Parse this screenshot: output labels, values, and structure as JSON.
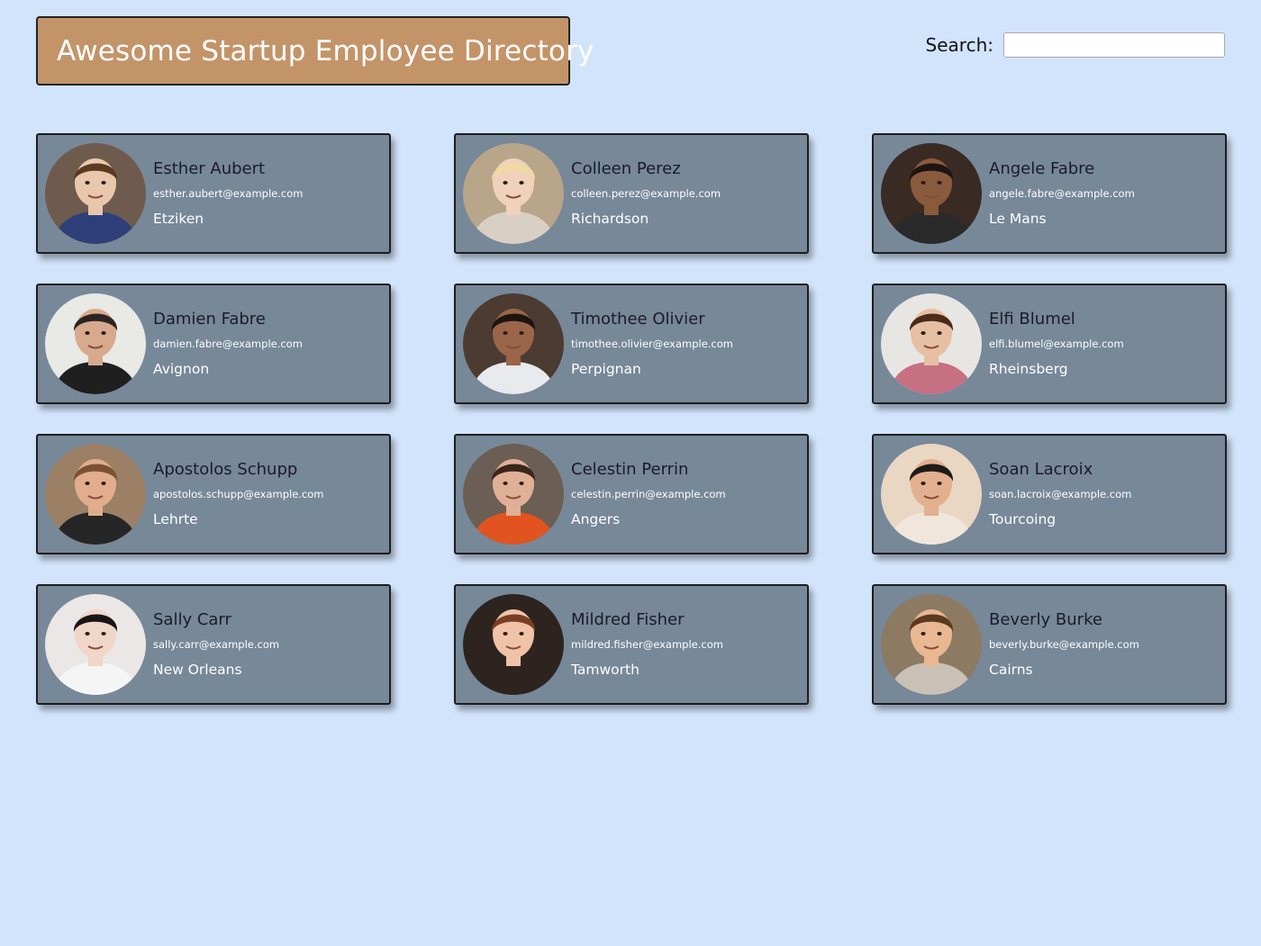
{
  "header": {
    "title": "Awesome Startup Employee Directory"
  },
  "search": {
    "label": "Search:",
    "value": "",
    "placeholder": ""
  },
  "employees": [
    {
      "name": "Esther Aubert",
      "email": "esther.aubert@example.com",
      "city": "Etziken",
      "avatar": {
        "bg": "#6f5b4d",
        "skin": "#e9c7ad",
        "hair": "#5a3b22",
        "shirt": "#2f3f7a"
      }
    },
    {
      "name": "Colleen Perez",
      "email": "colleen.perez@example.com",
      "city": "Richardson",
      "avatar": {
        "bg": "#b9a58a",
        "skin": "#f0d2bc",
        "hair": "#f1d9a3",
        "shirt": "#d9cfc4"
      }
    },
    {
      "name": "Angele Fabre",
      "email": "angele.fabre@example.com",
      "city": "Le Mans",
      "avatar": {
        "bg": "#3a2a24",
        "skin": "#8a5a3c",
        "hair": "#1c1512",
        "shirt": "#2a2a2a"
      }
    },
    {
      "name": "Damien Fabre",
      "email": "damien.fabre@example.com",
      "city": "Avignon",
      "avatar": {
        "bg": "#e9e9e6",
        "skin": "#d7a98d",
        "hair": "#2b2420",
        "shirt": "#1f1f1f"
      }
    },
    {
      "name": "Timothee Olivier",
      "email": "timothee.olivier@example.com",
      "city": "Perpignan",
      "avatar": {
        "bg": "#4c3b30",
        "skin": "#9a6548",
        "hair": "#1c1410",
        "shirt": "#e9eaee"
      }
    },
    {
      "name": "Elfi Blumel",
      "email": "elfi.blumel@example.com",
      "city": "Rheinsberg",
      "avatar": {
        "bg": "#e7e6e3",
        "skin": "#e6bfa4",
        "hair": "#4a2a18",
        "shirt": "#c76f83"
      }
    },
    {
      "name": "Apostolos Schupp",
      "email": "apostolos.schupp@example.com",
      "city": "Lehrte",
      "avatar": {
        "bg": "#9b8066",
        "skin": "#e2ad8c",
        "hair": "#7a5230",
        "shirt": "#262626"
      }
    },
    {
      "name": "Celestin Perrin",
      "email": "celestin.perrin@example.com",
      "city": "Angers",
      "avatar": {
        "bg": "#6b5e54",
        "skin": "#e0b096",
        "hair": "#3a261b",
        "shirt": "#e2541f"
      }
    },
    {
      "name": "Soan Lacroix",
      "email": "soan.lacroix@example.com",
      "city": "Tourcoing",
      "avatar": {
        "bg": "#e9d7c3",
        "skin": "#e2b08e",
        "hair": "#1d1a19",
        "shirt": "#f0e6dc"
      }
    },
    {
      "name": "Sally Carr",
      "email": "sally.carr@example.com",
      "city": "New Orleans",
      "avatar": {
        "bg": "#ebe7e7",
        "skin": "#f1d5c8",
        "hair": "#1a1414",
        "shirt": "#f5f5f5"
      }
    },
    {
      "name": "Mildred Fisher",
      "email": "mildred.fisher@example.com",
      "city": "Tamworth",
      "avatar": {
        "bg": "#2d2420",
        "skin": "#f0c3a8",
        "hair": "#7a3f22",
        "shirt": "#2d2420"
      }
    },
    {
      "name": "Beverly Burke",
      "email": "beverly.burke@example.com",
      "city": "Cairns",
      "avatar": {
        "bg": "#8d7a62",
        "skin": "#e9b792",
        "hair": "#5b3a22",
        "shirt": "#c9c1b6"
      }
    }
  ]
}
